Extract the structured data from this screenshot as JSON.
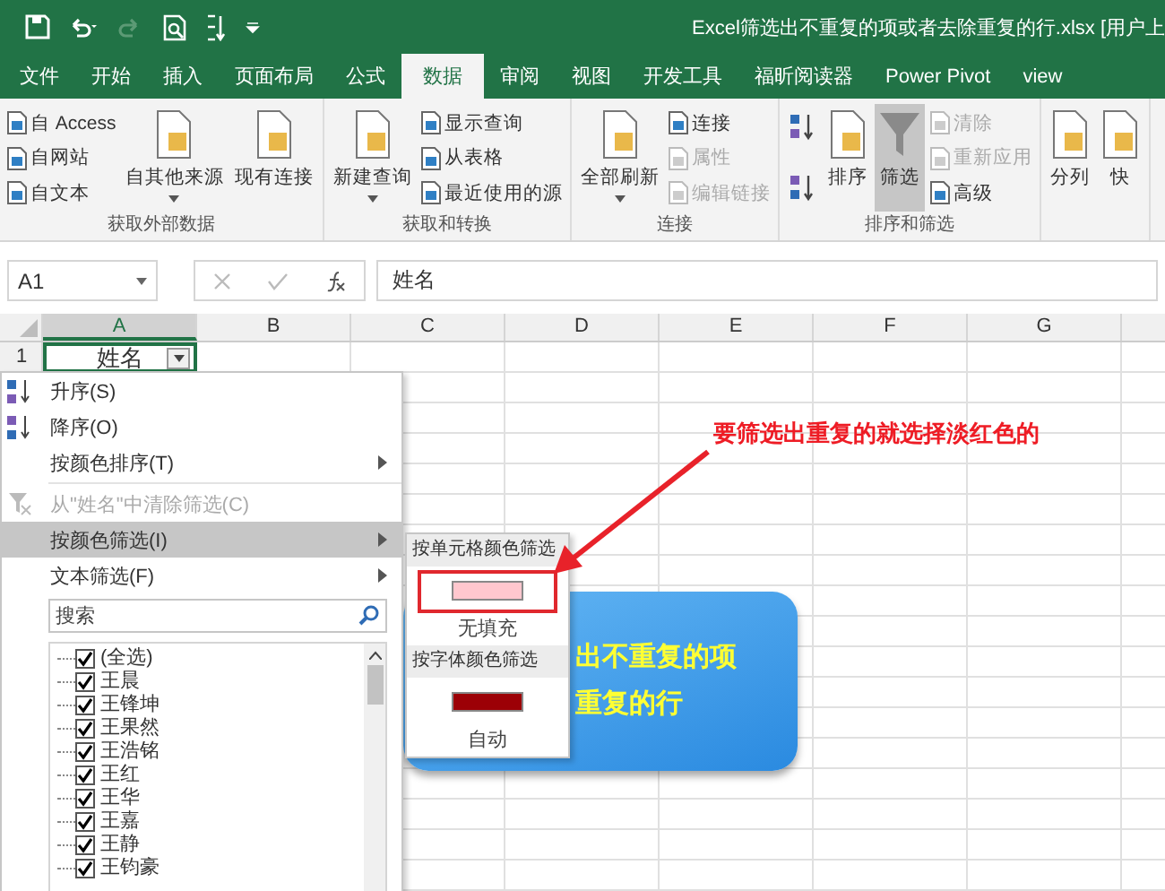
{
  "window": {
    "title": "Excel筛选出不重复的项或者去除重复的行.xlsx [用户上"
  },
  "tabs": [
    {
      "label": "文件",
      "selected": false
    },
    {
      "label": "开始",
      "selected": false
    },
    {
      "label": "插入",
      "selected": false
    },
    {
      "label": "页面布局",
      "selected": false
    },
    {
      "label": "公式",
      "selected": false
    },
    {
      "label": "数据",
      "selected": true
    },
    {
      "label": "审阅",
      "selected": false
    },
    {
      "label": "视图",
      "selected": false
    },
    {
      "label": "开发工具",
      "selected": false
    },
    {
      "label": "福昕阅读器",
      "selected": false
    },
    {
      "label": "Power Pivot",
      "selected": false
    },
    {
      "label": "view",
      "selected": false
    }
  ],
  "ribbon": {
    "groups": [
      {
        "label": "获取外部数据",
        "columns": [
          {
            "kind": "stack",
            "items": [
              {
                "label": "自 Access",
                "disabled": false
              },
              {
                "label": "自网站",
                "disabled": false
              },
              {
                "label": "自文本",
                "disabled": false
              }
            ]
          },
          {
            "kind": "large",
            "label": "自其他来源",
            "dropdown": true,
            "selected": false
          },
          {
            "kind": "large",
            "label": "现有连接",
            "dropdown": false,
            "selected": false
          }
        ]
      },
      {
        "label": "获取和转换",
        "columns": [
          {
            "kind": "large",
            "label": "新建查询",
            "dropdown": true,
            "selected": false
          },
          {
            "kind": "stack",
            "items": [
              {
                "label": "显示查询",
                "disabled": false
              },
              {
                "label": "从表格",
                "disabled": false
              },
              {
                "label": "最近使用的源",
                "disabled": false
              }
            ]
          }
        ]
      },
      {
        "label": "连接",
        "columns": [
          {
            "kind": "large",
            "label": "全部刷新",
            "dropdown": true,
            "selected": false
          },
          {
            "kind": "stack",
            "items": [
              {
                "label": "连接",
                "disabled": false
              },
              {
                "label": "属性",
                "disabled": true
              },
              {
                "label": "编辑链接",
                "disabled": true
              }
            ]
          }
        ]
      },
      {
        "label": "排序和筛选",
        "columns": [
          {
            "kind": "sort-icons"
          },
          {
            "kind": "large",
            "label": "排序",
            "dropdown": false,
            "selected": false
          },
          {
            "kind": "large",
            "label": "筛选",
            "dropdown": false,
            "selected": true
          },
          {
            "kind": "stack",
            "items": [
              {
                "label": "清除",
                "disabled": true
              },
              {
                "label": "重新应用",
                "disabled": true
              },
              {
                "label": "高级",
                "disabled": false
              }
            ]
          }
        ]
      },
      {
        "columns": [
          {
            "kind": "large",
            "label": "分列",
            "dropdown": false,
            "selected": false
          },
          {
            "kind": "large",
            "label": "快",
            "dropdown": false,
            "selected": false
          }
        ]
      }
    ]
  },
  "formula_bar": {
    "name_box": "A1",
    "value": "姓名"
  },
  "sheet": {
    "columns": [
      "A",
      "B",
      "C",
      "D",
      "E",
      "F",
      "G"
    ],
    "rows": [
      {
        "number": "1",
        "cells": [
          "姓名"
        ]
      }
    ]
  },
  "filter_menu": {
    "items": [
      {
        "kind": "sort-asc",
        "label": "升序(S)",
        "disabled": false,
        "selected": false,
        "submenu": false
      },
      {
        "kind": "sort-desc",
        "label": "降序(O)",
        "disabled": false,
        "selected": false,
        "submenu": false
      },
      {
        "kind": "plain",
        "label": "按颜色排序(T)",
        "disabled": false,
        "selected": false,
        "submenu": true
      },
      {
        "kind": "clear",
        "label": "从\"姓名\"中清除筛选(C)",
        "disabled": true,
        "selected": false,
        "submenu": false
      },
      {
        "kind": "plain",
        "label": "按颜色筛选(I)",
        "disabled": false,
        "selected": true,
        "submenu": true
      },
      {
        "kind": "plain",
        "label": "文本筛选(F)",
        "disabled": false,
        "selected": false,
        "submenu": true
      }
    ],
    "search": {
      "placeholder": "搜索"
    },
    "values": [
      {
        "label": "(全选)",
        "checked": true
      },
      {
        "label": "王晨",
        "checked": true
      },
      {
        "label": "王锋坤",
        "checked": true
      },
      {
        "label": "王果然",
        "checked": true
      },
      {
        "label": "王浩铭",
        "checked": true
      },
      {
        "label": "王红",
        "checked": true
      },
      {
        "label": "王华",
        "checked": true
      },
      {
        "label": "王嘉",
        "checked": true
      },
      {
        "label": "王静",
        "checked": true
      },
      {
        "label": "王钧豪",
        "checked": true
      }
    ]
  },
  "color_submenu": {
    "sections": [
      {
        "heading": "按单元格颜色筛选",
        "swatch": {
          "color": "#ffc7ce",
          "highlighted": true
        },
        "option": "无填充"
      },
      {
        "heading": "按字体颜色筛选",
        "swatch": {
          "color": "#9c0006",
          "highlighted": false
        },
        "option": "自动"
      }
    ]
  },
  "callout": {
    "lines": [
      "出不重复的项",
      "重复的行"
    ]
  },
  "annotation": {
    "text": "要筛选出重复的就选择淡红色的"
  }
}
